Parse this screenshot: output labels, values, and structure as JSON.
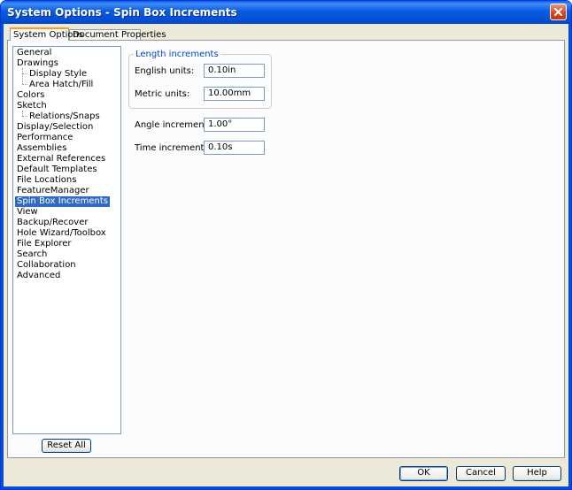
{
  "window": {
    "title": "System Options - Spin Box Increments",
    "close_icon": "close-icon"
  },
  "tabs": [
    {
      "label": "System Options",
      "active": true
    },
    {
      "label": "Document Properties",
      "active": false
    }
  ],
  "tree": {
    "items": [
      {
        "label": "General"
      },
      {
        "label": "Drawings"
      },
      {
        "label": "Display Style"
      },
      {
        "label": "Area Hatch/Fill"
      },
      {
        "label": "Colors"
      },
      {
        "label": "Sketch"
      },
      {
        "label": "Relations/Snaps"
      },
      {
        "label": "Display/Selection"
      },
      {
        "label": "Performance"
      },
      {
        "label": "Assemblies"
      },
      {
        "label": "External References"
      },
      {
        "label": "Default Templates"
      },
      {
        "label": "File Locations"
      },
      {
        "label": "FeatureManager"
      },
      {
        "label": "Spin Box Increments",
        "selected": true
      },
      {
        "label": "View"
      },
      {
        "label": "Backup/Recover"
      },
      {
        "label": "Hole Wizard/Toolbox"
      },
      {
        "label": "File Explorer"
      },
      {
        "label": "Search"
      },
      {
        "label": "Collaboration"
      },
      {
        "label": "Advanced"
      }
    ],
    "selection_color": "#316ac5"
  },
  "settings": {
    "length_group_title": "Length increments",
    "english_label": "English units:",
    "english_value": "0.10in",
    "metric_label": "Metric units:",
    "metric_value": "10.00mm",
    "angle_label": "Angle increments:",
    "angle_value": "1.00°",
    "time_label": "Time increments:",
    "time_value": "0.10s"
  },
  "buttons": {
    "reset_all": "Reset All",
    "ok": "OK",
    "cancel": "Cancel",
    "help": "Help"
  },
  "colors": {
    "titlebar": "#0a5ae0",
    "group_title": "#0046d5",
    "window_bg": "#ece9d8"
  }
}
